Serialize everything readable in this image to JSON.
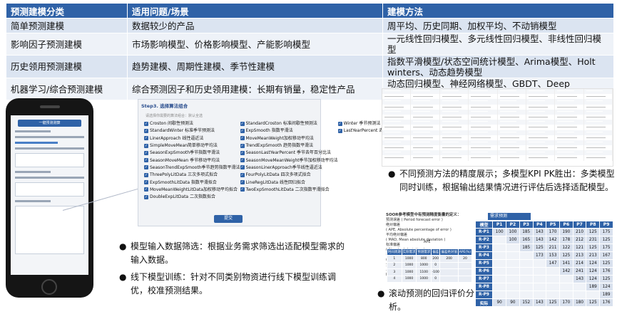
{
  "model_table": {
    "headers": [
      "预测建模分类",
      "适用问题/场景",
      "建模方法"
    ],
    "rows": [
      [
        "简单预测建模",
        "数据较少的产品",
        "周平均、历史同期、加权平均、不动销模型"
      ],
      [
        "影响因子预测建模",
        "市场影响模型、价格影响模型、产能影响模型",
        "一元线性回归模型、多元线性回归模型、非线性回归模型"
      ],
      [
        "历史领用预测建模",
        "趋势建模、周期性建模、季节性建模",
        "指数平滑模型/状态空间统计模型、Arima模型、Holt winters、动态趋势模型"
      ],
      [
        "机器学习/综合预测建模",
        "综合预测因子和历史领用建模：长期有销量，稳定性产品",
        "动态回归模型、神经网络模型、GBDT、Deep Learning"
      ]
    ]
  },
  "phone": {
    "header": "一键预测测算"
  },
  "algo_panel": {
    "title": "Step3. 选择算法组合",
    "hint": "请选择你需要的算法组合：默认全选",
    "rows": [
      [
        "Croston 间歇性预测法",
        "StandardCroston 标准间歇性预测法",
        "Winter 季节预测法"
      ],
      [
        "StandardWinter 标准季节预测法",
        "ExpSmooth 指数平滑法",
        "LastYearPercent 去年百分比法"
      ],
      [
        "LinerApproach 线性逼近法",
        "MoveMeanWeight加权移动平均法",
        ""
      ],
      [
        "SimpleMoveMean简单移动平均法",
        "TrendExpSmooth 趋势指数平滑法",
        ""
      ],
      [
        "SeasonExpSmooth季节指数平滑法",
        "SeasonLastYearPercent 季节去年百分比法",
        ""
      ],
      [
        "SeasonMoveMean 季节移动平均法",
        "SeasonMoveMeanWeight季节加权移动平均法",
        ""
      ],
      [
        "SeasonTrendExpSmooth季节趋势指数平滑法",
        "SeasonLinerApproach季节线性逼近法",
        ""
      ],
      [
        "ThreePolyLitData 三次多项式拟合",
        "FourPolyLitData 四次多项式拟合",
        ""
      ],
      [
        "ExpSmoothLitData 指数平滑拟合",
        "LineRegLitData 线性回归拟合",
        ""
      ],
      [
        "MoveMeanWeightLitData加权移动平均拟合",
        "TwoExpSmoothLitData 二次指数平滑拟合",
        ""
      ],
      [
        "DoubleExpLitData 二次指数拟合",
        "",
        ""
      ]
    ],
    "submit": "提交"
  },
  "bullets": {
    "b1": "模型输入数据筛选：根据业务需求筛选出适配模型需求的输入数据。",
    "b2": "线下模型训练：针对不同类别物资进行线下模型训练调优，校准预测结果。",
    "b3": "不同预测方法的精度展示；多模型KPI PK胜出：多类模型同时训练，根据输出结果情况进行评估后选择适配模型。",
    "b4": "滚动预测的回归评价分析。"
  },
  "soor": {
    "title": "SOOR参考模型中有预测精度衡量的定义：",
    "lines": [
      "预测误差 ( Period forecast error )",
      "绝对偏差",
      "( APE, Absolute percentage of error )",
      "平均绝对偏差",
      "( MAD, Mean absolute deviation )",
      "标准偏差",
      "( Standard deviation )",
      "平均绝对偏差",
      "( Mean absolute percentage of error )",
      "分辨（预测准度）公式",
      "……为了对预测准确性进行度量",
      "Forecast Accuracy Measures"
    ],
    "ape": "APE",
    "headers": [
      "时间周期",
      "实际需求",
      "预测需求",
      "偏差",
      "偏差绝对值",
      "APE(%)"
    ],
    "rows": [
      [
        "1",
        "1000",
        "800",
        "200",
        "200",
        "20"
      ],
      [
        "2",
        "1000",
        "1000",
        "0",
        "",
        ""
      ],
      [
        "3",
        "1000",
        "1100",
        "-100",
        "",
        ""
      ],
      [
        "4",
        "1000",
        "1000",
        "0",
        "",
        ""
      ]
    ]
  },
  "rolling": {
    "title": "需求预测",
    "headers": [
      "模型",
      "P1",
      "P2",
      "P3",
      "P4",
      "P5",
      "P6",
      "P7",
      "P8",
      "P9"
    ],
    "rows": [
      [
        "R-P1",
        "100",
        "100",
        "185",
        "143",
        "170",
        "190",
        "210",
        "125",
        "175"
      ],
      [
        "R-P2",
        "",
        "100",
        "165",
        "143",
        "142",
        "178",
        "212",
        "231",
        "125"
      ],
      [
        "R-P3",
        "",
        "",
        "185",
        "125",
        "211",
        "122",
        "121",
        "125",
        "175"
      ],
      [
        "R-P4",
        "",
        "",
        "",
        "173",
        "153",
        "125",
        "213",
        "213",
        "167"
      ],
      [
        "R-P5",
        "",
        "",
        "",
        "",
        "147",
        "141",
        "214",
        "124",
        "125"
      ],
      [
        "R-P6",
        "",
        "",
        "",
        "",
        "",
        "142",
        "241",
        "124",
        "176"
      ],
      [
        "R-P7",
        "",
        "",
        "",
        "",
        "",
        "",
        "143",
        "124",
        "125"
      ],
      [
        "R-P8",
        "",
        "",
        "",
        "",
        "",
        "",
        "",
        "189",
        "124"
      ],
      [
        "R-P9",
        "",
        "",
        "",
        "",
        "",
        "",
        "",
        "",
        "189"
      ],
      [
        "实际",
        "90",
        "90",
        "152",
        "143",
        "125",
        "170",
        "180",
        "125",
        "176"
      ]
    ]
  },
  "colors": {
    "primary": "#2f62a7",
    "row_a": "#dbe4f1",
    "row_b": "#eef2f8"
  }
}
